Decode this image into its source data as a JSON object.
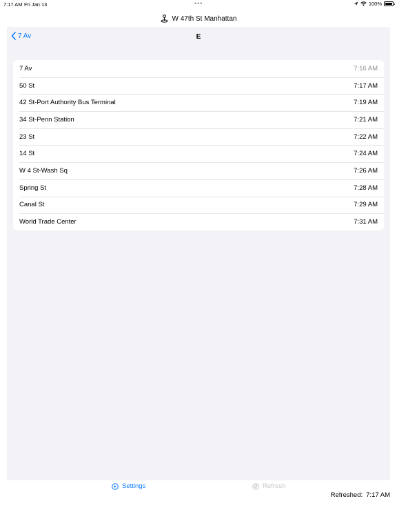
{
  "status_bar": {
    "time": "7:17 AM",
    "date": "Fri Jan 13",
    "dots": "•••",
    "battery": "100%"
  },
  "location": {
    "title": "W 47th St Manhattan"
  },
  "nav": {
    "back_label": "7 Av",
    "title": "E"
  },
  "stops": [
    {
      "name": "7 Av",
      "time": "7:16 AM"
    },
    {
      "name": "50 St",
      "time": "7:17 AM"
    },
    {
      "name": "42 St-Port Authority Bus Terminal",
      "time": "7:19 AM"
    },
    {
      "name": "34 St-Penn Station",
      "time": "7:21 AM"
    },
    {
      "name": "23 St",
      "time": "7:22 AM"
    },
    {
      "name": "14 St",
      "time": "7:24 AM"
    },
    {
      "name": "W 4 St-Wash Sq",
      "time": "7:26 AM"
    },
    {
      "name": "Spring St",
      "time": "7:28 AM"
    },
    {
      "name": "Canal St",
      "time": "7:29 AM"
    },
    {
      "name": "World Trade Center",
      "time": "7:31 AM"
    }
  ],
  "toolbar": {
    "settings_label": "Settings",
    "refresh_label": "Refresh",
    "refreshed_label": "Refreshed:",
    "refreshed_time": "7:17 AM"
  },
  "colors": {
    "accent": "#0a7aff",
    "background": "#f2f2f7",
    "disabled": "#c7c7cc",
    "secondary_text": "#8e8e93"
  }
}
